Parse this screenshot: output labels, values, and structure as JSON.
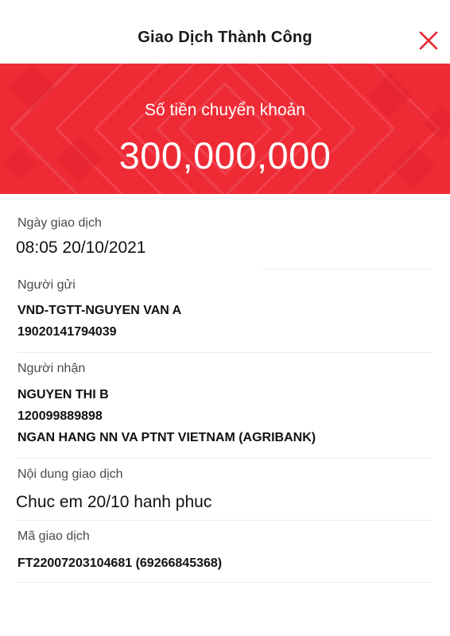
{
  "header": {
    "title": "Giao Dịch Thành Công",
    "close_icon": "close-icon",
    "close_color": "#e8212e"
  },
  "banner": {
    "label": "Số tiền chuyển khoản",
    "amount": "300,000,000",
    "background_color": "#ee2a35"
  },
  "details": {
    "date": {
      "label": "Ngày giao dịch",
      "value": "08:05 20/10/2021"
    },
    "sender": {
      "label": "Người gửi",
      "name": "VND-TGTT-NGUYEN VAN A",
      "account": "19020141794039"
    },
    "receiver": {
      "label": "Người nhận",
      "name": "NGUYEN THI B",
      "account": "120099889898",
      "bank": "NGAN HANG NN VA PTNT VIETNAM (AGRIBANK)"
    },
    "content": {
      "label": "Nội dung giao dịch",
      "value": "Chuc em 20/10 hanh phuc"
    },
    "transaction_id": {
      "label": "Mã giao dịch",
      "value": "FT22007203104681 (69266845368)"
    }
  }
}
